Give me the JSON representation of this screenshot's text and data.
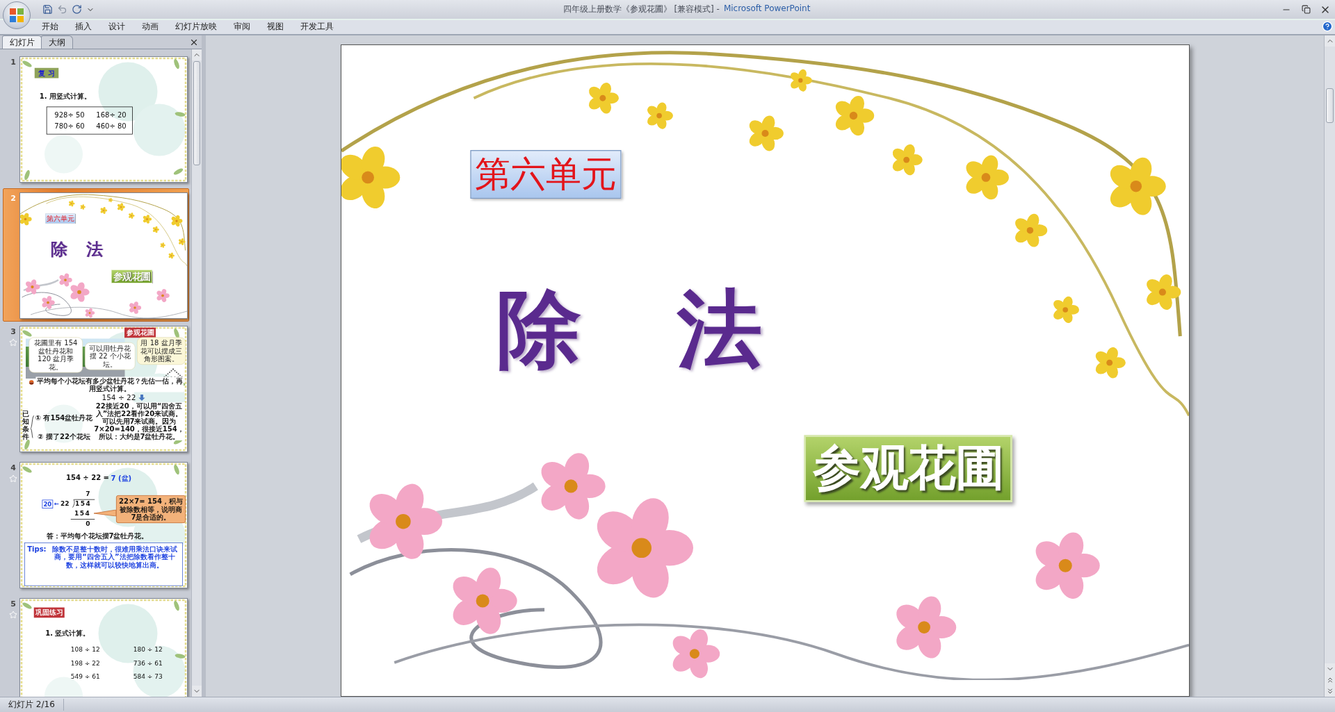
{
  "window": {
    "title": "四年级上册数学《参观花圃》 [兼容模式] -",
    "app_name": "Microsoft PowerPoint"
  },
  "ribbon_tabs": [
    {
      "label": "开始"
    },
    {
      "label": "插入"
    },
    {
      "label": "设计"
    },
    {
      "label": "动画"
    },
    {
      "label": "幻灯片放映"
    },
    {
      "label": "审阅"
    },
    {
      "label": "视图"
    },
    {
      "label": "开发工具"
    }
  ],
  "panel_tabs": [
    {
      "label": "幻灯片",
      "selected": true
    },
    {
      "label": "大纲",
      "selected": false
    }
  ],
  "slides": [
    {
      "number": "1",
      "selected": false,
      "animated": false,
      "kind": "review",
      "tag": "复 习",
      "instruction": "1. 用竖式计算。",
      "problems": [
        "928÷ 50",
        "168÷ 20",
        "780÷ 60",
        "460÷ 80"
      ]
    },
    {
      "number": "2",
      "selected": true,
      "animated": false,
      "kind": "title",
      "unit": "第六单元",
      "heading": "除 法",
      "button": "参观花圃"
    },
    {
      "number": "3",
      "selected": false,
      "animated": true,
      "kind": "scene",
      "tag": "参观花圃",
      "bubbles": [
        "花圃里有 154 盆牡丹花和 120 盆月季花。",
        "可以用牡丹花摆 22 个小花坛。",
        "用 18 盆月季花可以摆成三角形图案。"
      ],
      "question": "平均每个小花坛有多少盆牡丹花？先估一估，再用竖式计算。",
      "expression": "154 ÷ 22",
      "known_label": "已知条件",
      "conditions": [
        "① 有154盆牡丹花",
        "② 摆了22个花坛"
      ],
      "explanation": "22接近20，可以用“四舍五入”法把22看作20来试商。可以先用7来试商。因为7×20=140，很接近154，所以：大约是7盆牡丹花。"
    },
    {
      "number": "4",
      "selected": false,
      "animated": true,
      "kind": "solution",
      "equation": "154 ÷ 22 =",
      "result": "7 (盆)",
      "quotient": "7",
      "estimate": "20",
      "arrow": "←",
      "divisor": "22",
      "dividend": "154",
      "product": "154",
      "remainder": "0",
      "callout": "22×7= 154，积与被除数相等，说明商7是合适的。",
      "answer": "答：平均每个花坛摆7盆牡丹花。",
      "tips_label": "Tips:",
      "tips": "除数不是整十数时，很难用乘法口诀来试商，要用“四舍五入”法把除数看作整十数，这样就可以较快地算出商。"
    },
    {
      "number": "5",
      "selected": false,
      "animated": true,
      "kind": "practice",
      "tag": "巩固练习",
      "instruction": "1. 竖式计算。",
      "problems": [
        "108 ÷ 12",
        "180 ÷ 12",
        "198 ÷ 22",
        "736 ÷ 61",
        "549 ÷ 61",
        "584 ÷ 73"
      ]
    }
  ],
  "current_slide": {
    "kind": "title",
    "unit": "第六单元",
    "heading": "除 法",
    "button": "参观花圃"
  },
  "status_bar": {
    "slide_info": "幻灯片 2/16"
  }
}
